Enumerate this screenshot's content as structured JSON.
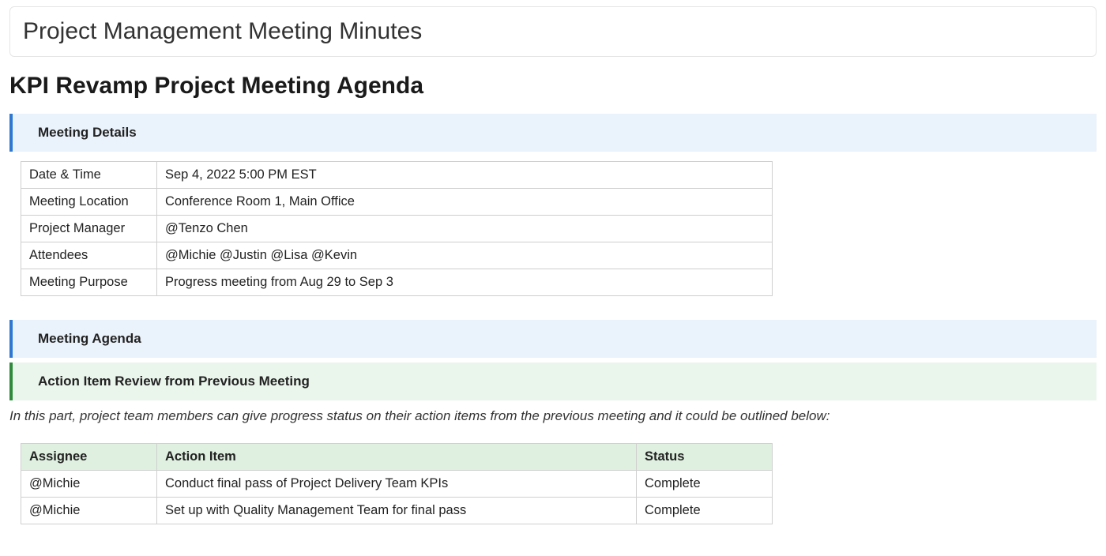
{
  "document": {
    "title": "Project Management Meeting Minutes",
    "heading": "KPI Revamp Project Meeting Agenda"
  },
  "sections": {
    "meeting_details": "Meeting Details",
    "meeting_agenda": "Meeting Agenda",
    "action_item_review": "Action Item Review from Previous Meeting"
  },
  "details": {
    "rows": [
      {
        "label": "Date & Time",
        "value": "Sep 4, 2022 5:00 PM EST"
      },
      {
        "label": "Meeting Location",
        "value": "Conference Room 1, Main Office"
      },
      {
        "label": "Project Manager",
        "value": "@Tenzo Chen"
      },
      {
        "label": "Attendees",
        "value": "@Michie @Justin @Lisa @Kevin"
      },
      {
        "label": "Meeting Purpose",
        "value": "Progress meeting from Aug 29 to Sep 3"
      }
    ]
  },
  "note": "In this part, project team members can give progress status on their action items from the previous meeting and it could be outlined below:",
  "action_items": {
    "headers": {
      "assignee": "Assignee",
      "item": "Action Item",
      "status": "Status"
    },
    "rows": [
      {
        "assignee": "@Michie",
        "item": "Conduct final pass of Project Delivery Team KPIs",
        "status": "Complete"
      },
      {
        "assignee": "@Michie",
        "item": "Set up with Quality Management Team for final pass",
        "status": "Complete"
      }
    ]
  }
}
